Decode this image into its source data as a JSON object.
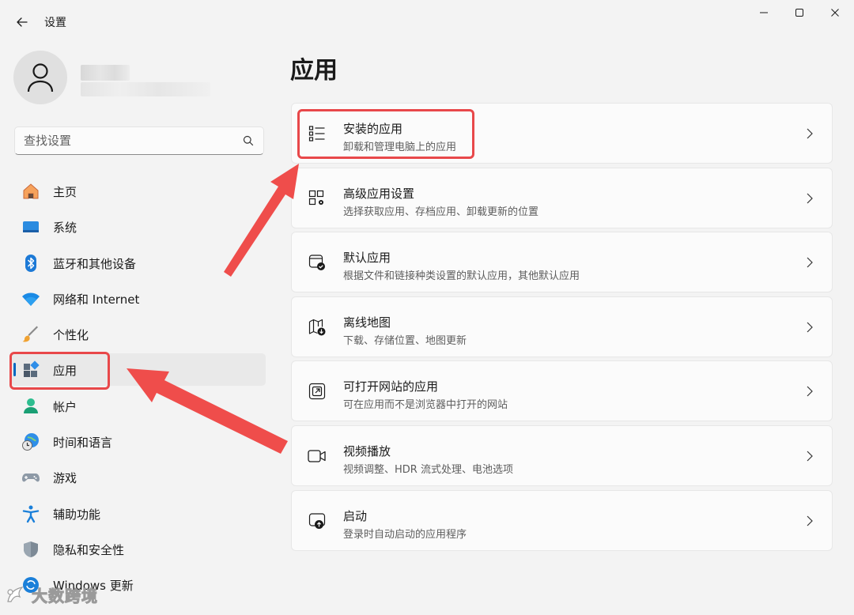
{
  "window": {
    "title": "设置"
  },
  "search": {
    "placeholder": "查找设置"
  },
  "sidebar": {
    "items": [
      {
        "label": "主页",
        "icon": "home-icon"
      },
      {
        "label": "系统",
        "icon": "system-icon"
      },
      {
        "label": "蓝牙和其他设备",
        "icon": "bluetooth-icon"
      },
      {
        "label": "网络和 Internet",
        "icon": "wifi-icon"
      },
      {
        "label": "个性化",
        "icon": "brush-icon"
      },
      {
        "label": "应用",
        "icon": "apps-icon",
        "selected": true
      },
      {
        "label": "帐户",
        "icon": "account-icon"
      },
      {
        "label": "时间和语言",
        "icon": "time-language-icon"
      },
      {
        "label": "游戏",
        "icon": "gamepad-icon"
      },
      {
        "label": "辅助功能",
        "icon": "accessibility-icon"
      },
      {
        "label": "隐私和安全性",
        "icon": "shield-icon"
      },
      {
        "label": "Windows 更新",
        "icon": "update-icon"
      }
    ]
  },
  "main": {
    "title": "应用",
    "cards": [
      {
        "title": "安装的应用",
        "subtitle": "卸载和管理电脑上的应用",
        "icon": "list-icon"
      },
      {
        "title": "高级应用设置",
        "subtitle": "选择获取应用、存档应用、卸载更新的位置",
        "icon": "advanced-apps-icon"
      },
      {
        "title": "默认应用",
        "subtitle": "根据文件和链接种类设置的默认应用，其他默认应用",
        "icon": "default-apps-icon"
      },
      {
        "title": "离线地图",
        "subtitle": "下载、存储位置、地图更新",
        "icon": "offline-map-icon"
      },
      {
        "title": "可打开网站的应用",
        "subtitle": "可在应用而不是浏览器中打开的网站",
        "icon": "open-link-icon"
      },
      {
        "title": "视频播放",
        "subtitle": "视频调整、HDR 流式处理、电池选项",
        "icon": "video-icon"
      },
      {
        "title": "启动",
        "subtitle": "登录时自动启动的应用程序",
        "icon": "startup-icon"
      }
    ]
  },
  "watermark": {
    "text": "大数跨境"
  },
  "colors": {
    "accent": "#0067c0",
    "highlight": "#e8484a",
    "background": "#f3f3f3",
    "card": "#fbfbfb"
  }
}
